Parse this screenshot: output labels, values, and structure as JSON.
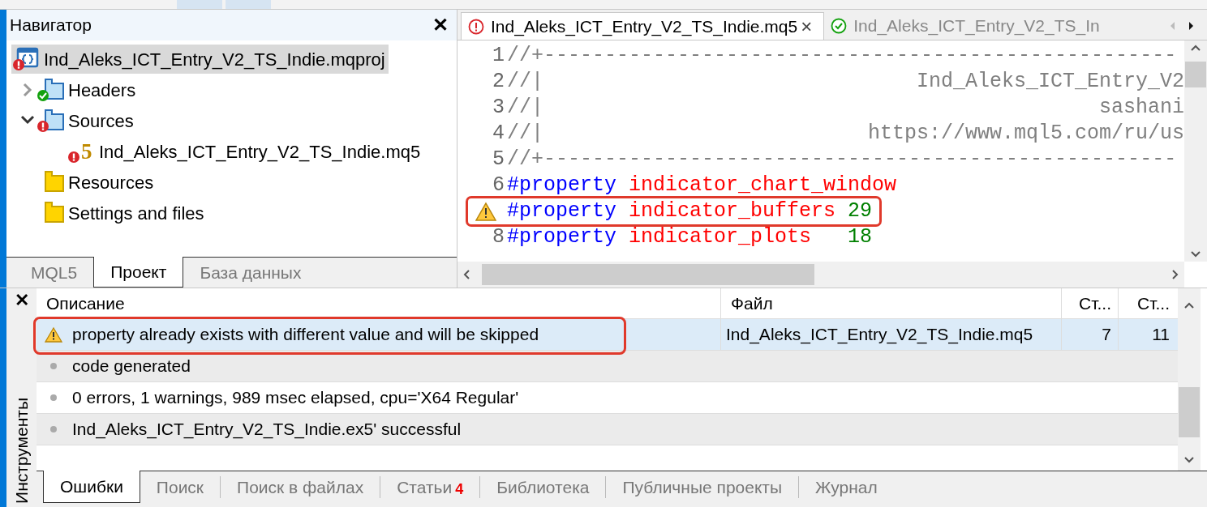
{
  "navigator": {
    "title": "Навигатор",
    "close": "✕",
    "tree": [
      {
        "label": "Ind_Aleks_ICT_Entry_V2_TS_Indie.mqproj",
        "kind": "project",
        "error": true,
        "selected": true,
        "children": [
          {
            "label": "Headers",
            "kind": "folder",
            "error": false,
            "ok": true,
            "expanded": false,
            "selected": false
          },
          {
            "label": "Sources",
            "kind": "folder",
            "error": true,
            "expanded": true,
            "selected": false,
            "children": [
              {
                "label": "Ind_Aleks_ICT_Entry_V2_TS_Indie.mq5",
                "kind": "file",
                "glyph": "5",
                "error": true,
                "selected": false
              }
            ]
          },
          {
            "label": "Resources",
            "kind": "store",
            "error": false,
            "ok": false,
            "selected": false
          },
          {
            "label": "Settings and files",
            "kind": "store",
            "error": false,
            "ok": false,
            "selected": false
          }
        ]
      }
    ],
    "tabs": [
      {
        "label": "MQL5",
        "selected": false
      },
      {
        "label": "Проект",
        "selected": true
      },
      {
        "label": "База данных",
        "selected": false
      }
    ]
  },
  "editor": {
    "tabs": [
      {
        "label": "Ind_Aleks_ICT_Entry_V2_TS_Indie.mq5",
        "error": true,
        "selected": true,
        "close": "×"
      },
      {
        "label": "Ind_Aleks_ICT_Entry_V2_TS_In",
        "error": false,
        "selected": false
      }
    ],
    "lines": [
      {
        "number": "1",
        "warning": false,
        "highlighted": false,
        "tokens": [
          {
            "kind": "comment",
            "text": "//+----------------------------------------------------"
          }
        ]
      },
      {
        "number": "2",
        "warning": false,
        "highlighted": false,
        "tokens": [
          {
            "kind": "comment",
            "text": "//|"
          },
          {
            "kind": "comment-right",
            "text": "Ind_Aleks_ICT_Entry_V2"
          }
        ]
      },
      {
        "number": "3",
        "warning": false,
        "highlighted": false,
        "tokens": [
          {
            "kind": "comment",
            "text": "//|"
          },
          {
            "kind": "comment-right",
            "text": "sashani"
          }
        ]
      },
      {
        "number": "4",
        "warning": false,
        "highlighted": false,
        "tokens": [
          {
            "kind": "comment",
            "text": "//|"
          },
          {
            "kind": "comment-right",
            "text": "https://www.mql5.com/ru/us"
          }
        ]
      },
      {
        "number": "5",
        "warning": false,
        "highlighted": false,
        "tokens": [
          {
            "kind": "comment",
            "text": "//+----------------------------------------------------"
          }
        ]
      },
      {
        "number": "6",
        "warning": false,
        "highlighted": false,
        "tokens": [
          {
            "kind": "keyword",
            "text": "#property"
          },
          {
            "kind": "name",
            "text": "indicator_chart_window"
          }
        ]
      },
      {
        "warning": true,
        "highlighted": true,
        "tokens": [
          {
            "kind": "keyword",
            "text": "#property"
          },
          {
            "kind": "name",
            "text": "indicator_buffers"
          },
          {
            "kind": "number",
            "text": "29"
          }
        ]
      },
      {
        "number": "8",
        "warning": false,
        "highlighted": false,
        "tokens": [
          {
            "kind": "keyword",
            "text": "#property"
          },
          {
            "kind": "name",
            "text": "indicator_plots  "
          },
          {
            "kind": "number",
            "text": "18"
          }
        ]
      }
    ]
  },
  "tools": {
    "title": "Инструменты",
    "close": "✕",
    "columns": [
      "Описание",
      "Файл",
      "Ст...",
      "Ст..."
    ],
    "rows": [
      {
        "kind": "warning",
        "description": "property already exists with different value and will be skipped",
        "file": "Ind_Aleks_ICT_Entry_V2_TS_Indie.mq5",
        "column_3": "7",
        "column_4": "11",
        "selected": true,
        "highlighted": true
      },
      {
        "kind": "info",
        "description": "code generated",
        "selected": false,
        "highlighted": false
      },
      {
        "kind": "info",
        "description": "0 errors, 1 warnings, 989 msec elapsed, cpu='X64 Regular'",
        "selected": false,
        "highlighted": false
      },
      {
        "kind": "info",
        "description": "Ind_Aleks_ICT_Entry_V2_TS_Indie.ex5' successful",
        "selected": false,
        "highlighted": false
      }
    ],
    "tabs": [
      {
        "label": "Ошибки",
        "selected": true
      },
      {
        "label": "Поиск",
        "selected": false
      },
      {
        "label": "Поиск в файлах",
        "selected": false
      },
      {
        "label": "Статьи",
        "badge": "4",
        "selected": false
      },
      {
        "label": "Библиотека",
        "selected": false
      },
      {
        "label": "Публичные проекты",
        "selected": false
      },
      {
        "label": "Журнал",
        "selected": false
      }
    ]
  }
}
